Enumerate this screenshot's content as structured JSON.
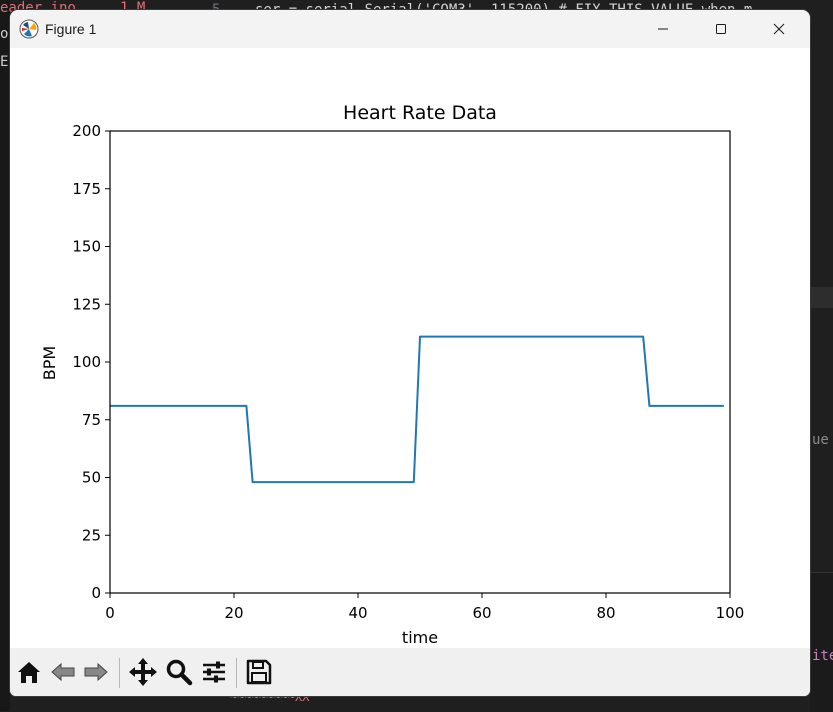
{
  "window": {
    "title": "Figure 1",
    "minimize_icon": "minimize-icon",
    "maximize_icon": "maximize-icon",
    "close_icon": "close-icon"
  },
  "background_editor": {
    "left_fragment_1": "eader.ino",
    "left_fragment_2": "ot",
    "left_fragment_3": "E.",
    "badge": "1 M",
    "line_number": "5",
    "code_fragment": "ser = serial.Serial('COM3', 115200)  # FIX THIS VALUE when m",
    "right_fragment_1": "ue",
    "right_fragment_2": "ite",
    "bottom_fragment": "~~~~~~~~~XX"
  },
  "toolbar": {
    "icons": [
      "home-icon",
      "back-arrow-icon",
      "forward-arrow-icon",
      "pan-icon",
      "zoom-icon",
      "configure-subplots-icon",
      "save-icon"
    ]
  },
  "chart_data": {
    "type": "line",
    "title": "Heart Rate Data",
    "xlabel": "time",
    "ylabel": "BPM",
    "xlim": [
      0,
      100
    ],
    "ylim": [
      0,
      200
    ],
    "xticks": [
      0,
      20,
      40,
      60,
      80,
      100
    ],
    "yticks": [
      0,
      25,
      50,
      75,
      100,
      125,
      150,
      175,
      200
    ],
    "grid": false,
    "line_color": "#1f77b4",
    "series": [
      {
        "x": [
          0,
          22,
          23,
          49,
          50,
          86,
          87,
          99
        ],
        "values": [
          81,
          81,
          48,
          48,
          111,
          111,
          81,
          81
        ]
      }
    ]
  }
}
